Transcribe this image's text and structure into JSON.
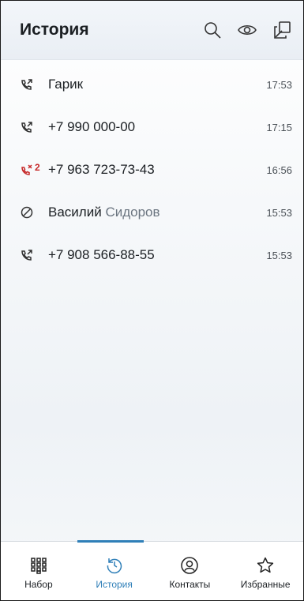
{
  "header": {
    "title": "История",
    "icons": [
      "search-icon",
      "eye-icon",
      "copy-icon"
    ]
  },
  "calls": [
    {
      "name": "Гарик",
      "name_sub": "",
      "time": "17:53",
      "icon": "outgoing-call-icon",
      "missed_count": ""
    },
    {
      "name": "+7 990 000-00",
      "name_sub": "",
      "time": "17:15",
      "icon": "outgoing-call-icon",
      "missed_count": ""
    },
    {
      "name": "+7 963 723-73-43",
      "name_sub": "",
      "time": "16:56",
      "icon": "missed-call-icon",
      "missed_count": "2"
    },
    {
      "name": "Василий",
      "name_sub": "Сидоров",
      "time": "15:53",
      "icon": "blocked-icon",
      "missed_count": ""
    },
    {
      "name": "+7 908 566-88-55",
      "name_sub": "",
      "time": "15:53",
      "icon": "outgoing-call-icon",
      "missed_count": ""
    }
  ],
  "tabs": [
    {
      "label": "Набор",
      "icon": "dialpad-icon",
      "active": false
    },
    {
      "label": "История",
      "icon": "history-icon",
      "active": true
    },
    {
      "label": "Контакты",
      "icon": "contacts-icon",
      "active": false
    },
    {
      "label": "Избранные",
      "icon": "star-icon",
      "active": false
    }
  ],
  "colors": {
    "accent": "#2f7fb8",
    "missed": "#c62828"
  }
}
